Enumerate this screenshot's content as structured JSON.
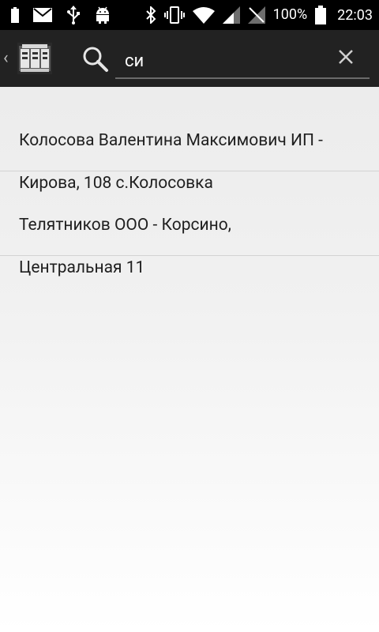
{
  "status_bar": {
    "battery_percent": "100%",
    "time": "22:03",
    "icons": [
      "battery-small-icon",
      "mail-icon",
      "usb-icon",
      "android-icon",
      "bluetooth-icon",
      "vibrate-icon",
      "wifi-icon",
      "signal-icon",
      "no-sim-icon",
      "battery-icon"
    ]
  },
  "action_bar": {
    "up_icon": "chevron-left-icon",
    "logo_icon": "app-logo-icon",
    "search_icon": "search-icon",
    "search_value": "си",
    "clear_icon": "close-icon"
  },
  "results": [
    {
      "line1": "Колосова Валентина Максимович ИП -",
      "line2": "Кирова, 108 с.Колосовка"
    },
    {
      "line1": "Телятников ООО - Корсино,",
      "line2": "Центральная 11"
    }
  ],
  "colors": {
    "status_bar_bg": "#000000",
    "action_bar_bg": "#222222",
    "list_bg": "#ececec",
    "divider": "#d3d3d3",
    "text": "#1f1f1f"
  }
}
